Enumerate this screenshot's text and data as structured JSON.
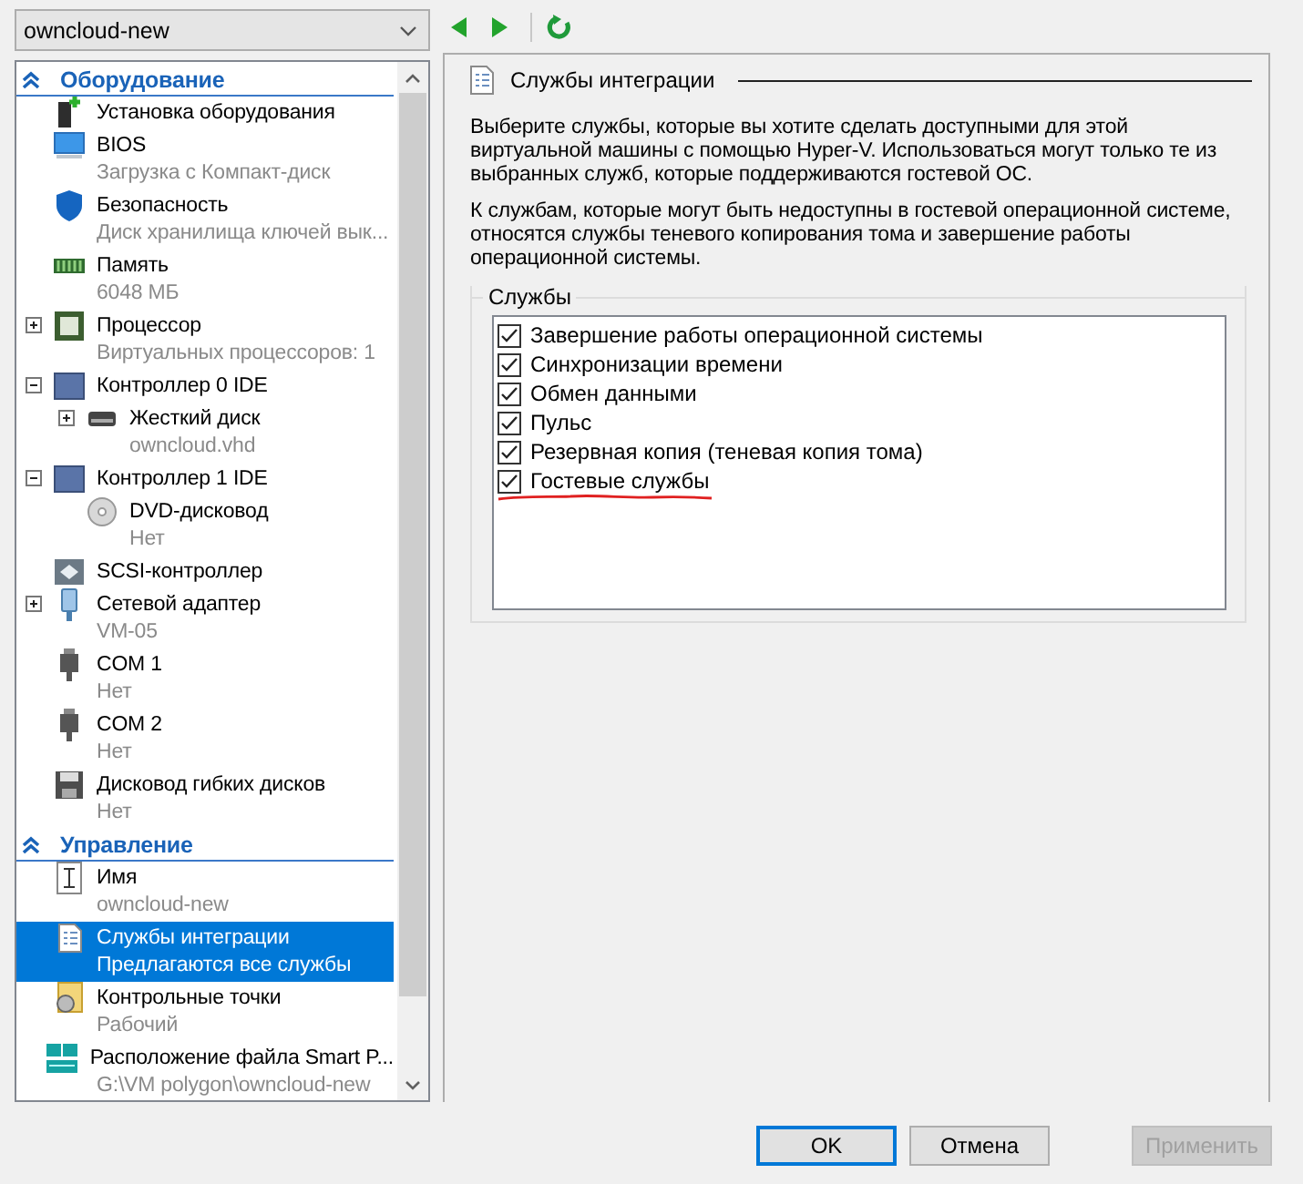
{
  "vm_selector": {
    "value": "owncloud-new"
  },
  "toolbar": [
    {
      "kind": "back"
    },
    {
      "kind": "forward"
    },
    {
      "kind": "refresh"
    }
  ],
  "sidebar": {
    "sections": [
      {
        "title": "Оборудование",
        "expanded": true,
        "items": [
          {
            "kind": "add-hardware",
            "title": "Установка оборудования",
            "selected": false
          },
          {
            "kind": "bios",
            "title": "BIOS",
            "subtitle": "Загрузка с Компакт-диск",
            "selected": false
          },
          {
            "kind": "security",
            "title": "Безопасность",
            "subtitle": "Диск хранилища ключей вык...",
            "selected": false
          },
          {
            "kind": "memory",
            "title": "Память",
            "subtitle": "6048 МБ",
            "selected": false
          },
          {
            "kind": "cpu",
            "title": "Процессор",
            "subtitle": "Виртуальных процессоров: 1",
            "expanded": false,
            "selected": false
          },
          {
            "kind": "controller",
            "title": "Контроллер 0 IDE",
            "expanded": true,
            "selected": false,
            "children": [
              {
                "kind": "hdd",
                "title": "Жесткий диск",
                "subtitle": "owncloud.vhd",
                "expanded": false,
                "selected": false
              }
            ]
          },
          {
            "kind": "controller",
            "title": "Контроллер 1 IDE",
            "expanded": true,
            "selected": false,
            "children": [
              {
                "kind": "dvd",
                "title": "DVD-дисковод",
                "subtitle": "Нет",
                "selected": false
              }
            ]
          },
          {
            "kind": "scsi",
            "title": "SCSI-контроллер",
            "selected": false
          },
          {
            "kind": "network",
            "title": "Сетевой адаптер",
            "subtitle": "VM-05",
            "expanded": false,
            "selected": false
          },
          {
            "kind": "com",
            "title": "COM 1",
            "subtitle": "Нет",
            "selected": false
          },
          {
            "kind": "com",
            "title": "COM 2",
            "subtitle": "Нет",
            "selected": false
          },
          {
            "kind": "floppy",
            "title": "Дисковод гибких дисков",
            "subtitle": "Нет",
            "selected": false
          }
        ]
      },
      {
        "title": "Управление",
        "expanded": true,
        "items": [
          {
            "kind": "name",
            "title": "Имя",
            "subtitle": "owncloud-new",
            "selected": false
          },
          {
            "kind": "integration",
            "title": "Службы интеграции",
            "subtitle": "Предлагаются все службы",
            "selected": true
          },
          {
            "kind": "checkpoint",
            "title": "Контрольные точки",
            "subtitle": "Рабочий",
            "selected": false
          },
          {
            "kind": "paging",
            "title": "Расположение файла Smart P...",
            "subtitle": "G:\\VM polygon\\owncloud-new",
            "selected": false
          }
        ]
      }
    ]
  },
  "panel": {
    "title": "Службы интеграции",
    "paragraphs": [
      "Выберите службы, которые вы хотите сделать доступными для этой виртуальной машины с помощью Hyper-V. Использоваться могут только те из выбранных служб, которые поддерживаются гостевой ОС.",
      "К службам, которые могут быть недоступны в гостевой операционной системе, относятся службы теневого копирования тома и завершение работы операционной системы."
    ],
    "group": {
      "title": "Службы",
      "services": [
        {
          "label": "Завершение работы операционной системы",
          "checked": true
        },
        {
          "label": "Синхронизации времени",
          "checked": true
        },
        {
          "label": "Обмен данными",
          "checked": true
        },
        {
          "label": "Пульс",
          "checked": true
        },
        {
          "label": "Резервная копия (теневая копия тома)",
          "checked": true
        },
        {
          "label": "Гостевые службы",
          "checked": true,
          "underlined": true
        }
      ]
    }
  },
  "buttons": [
    {
      "label": "OK",
      "default": true,
      "disabled": false
    },
    {
      "label": "Отмена",
      "default": false,
      "disabled": false
    },
    {
      "label": "Применить",
      "default": false,
      "disabled": true
    }
  ]
}
